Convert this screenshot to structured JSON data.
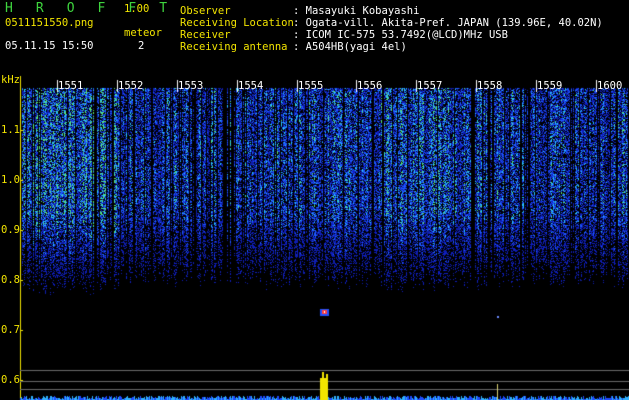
{
  "app": {
    "logo": "H R O F F T",
    "version": "1.00"
  },
  "file": {
    "name": "0511151550.png",
    "datetime": "05.11.15 15:50"
  },
  "meteor": {
    "label": "meteor",
    "count": "2"
  },
  "info": [
    {
      "label": "Observer",
      "value": ": Masayuki Kobayashi"
    },
    {
      "label": "Receiving Location",
      "value": ": Ogata-vill. Akita-Pref. JAPAN (139.96E, 40.02N)"
    },
    {
      "label": "Receiver",
      "value": ": ICOM IC-575 53.7492(@LCD)MHz USB"
    },
    {
      "label": "Receiving antenna",
      "value": ": A504HB(yagi 4el)"
    }
  ],
  "axis": {
    "unit": "kHz",
    "time_ticks": [
      "1551",
      "1552",
      "1553",
      "1554",
      "1555",
      "1556",
      "1557",
      "1558",
      "1559",
      "1600"
    ],
    "freq_ticks": [
      "1.1",
      "1.0",
      "0.9",
      "0.8",
      "0.7",
      "0.6"
    ]
  },
  "colors": {
    "signal_blue": "#1e3cff",
    "signal_cyan": "#2fd0ff",
    "signal_green": "#6af06a",
    "meteor_red": "#ff4040",
    "marker_yellow": "#f2e400",
    "label_yellow": "#f2e400",
    "label_green": "#3ed43e"
  }
}
